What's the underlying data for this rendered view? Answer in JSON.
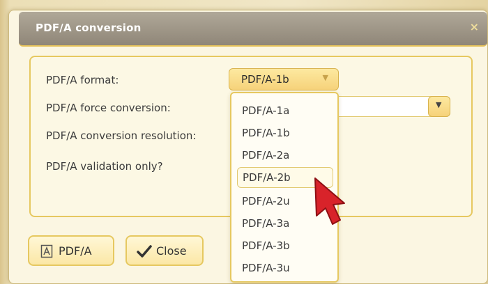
{
  "dialog": {
    "title": "PDF/A conversion",
    "close_glyph": "×"
  },
  "form": {
    "labels": {
      "format": "PDF/A format:",
      "force": "PDF/A force conversion:",
      "resolution": "PDF/A conversion resolution:",
      "validation": "PDF/A validation only?"
    },
    "format_selected": "PDF/A-1b",
    "dropdown_arrow": "▼"
  },
  "dropdown": {
    "options": [
      "PDF/A-1a",
      "PDF/A-1b",
      "PDF/A-2a",
      "PDF/A-2b",
      "PDF/A-2u",
      "PDF/A-3a",
      "PDF/A-3b",
      "PDF/A-3u"
    ],
    "hovered_option": "PDF/A-2b"
  },
  "buttons": {
    "pdfa_label": "PDF/A",
    "pdfa_icon": "pdf-document-icon",
    "close_label": "Close",
    "close_icon": "checkmark-icon"
  },
  "colors": {
    "accent": "#e6c860",
    "titlebar": "#9a9282",
    "cursor": "#d8232a"
  }
}
